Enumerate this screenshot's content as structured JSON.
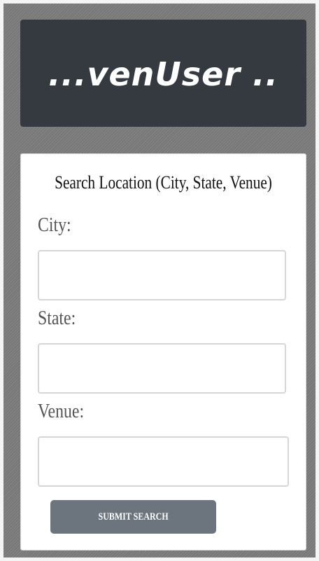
{
  "header": {
    "brand": "...venUser .."
  },
  "search_form": {
    "title": "Search Location (City, State, Venue)",
    "fields": [
      {
        "label": "City:",
        "value": "",
        "placeholder": ""
      },
      {
        "label": "State:",
        "value": "",
        "placeholder": ""
      },
      {
        "label": "Venue:",
        "value": "",
        "placeholder": ""
      }
    ],
    "submit_label": "SUBMIT SEARCH"
  },
  "colors": {
    "header_bg": "#343a40",
    "button_bg": "#6c757d",
    "page_bg": "#7d7d7d"
  }
}
